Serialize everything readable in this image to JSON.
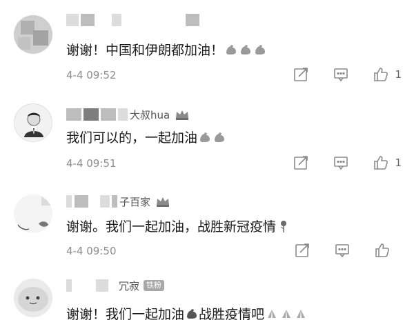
{
  "comments": [
    {
      "user_suffix": "",
      "text": "谢谢！中国和伊朗都加油！",
      "emojis": [
        "flexed-biceps-icon",
        "flexed-biceps-icon",
        "flexed-biceps-icon"
      ],
      "time": "4-4 09:52",
      "likes": "1"
    },
    {
      "user_suffix": "大叔hua",
      "text": "我们可以的，一起加油",
      "emojis": [
        "flexed-biceps-icon",
        "flexed-biceps-icon"
      ],
      "time": "4-4 09:51",
      "likes": "1"
    },
    {
      "user_suffix": "子百家",
      "text": "谢谢。我们一起加油，战胜新冠疫情",
      "emojis": [
        "rose-icon"
      ],
      "time": "4-4 09:50",
      "likes": ""
    },
    {
      "user_suffix": "冗寂",
      "badge": "铁粉",
      "text_part1": "谢谢！我们一起加油",
      "text_part2": "战胜疫情吧",
      "emojis": [
        "flexed-biceps-icon",
        "folded-hands-icon",
        "folded-hands-icon",
        "folded-hands-icon"
      ],
      "time": "",
      "likes": ""
    }
  ]
}
